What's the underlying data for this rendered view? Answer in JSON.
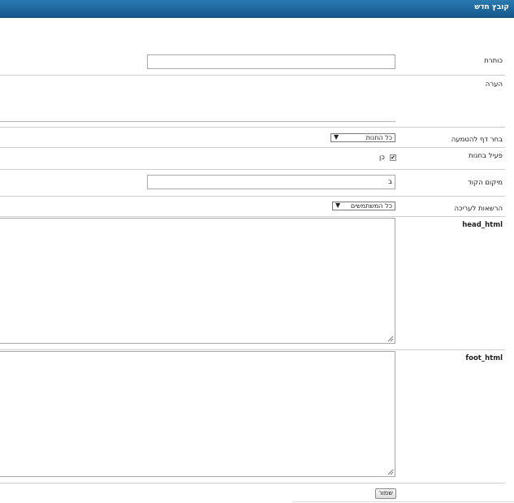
{
  "header": {
    "title": "קובץ חדש"
  },
  "form": {
    "title_label": "כותרת",
    "title_value": "",
    "note_label": "הערה",
    "theme_page_label": "בחר דף להטמעה",
    "theme_page_select": {
      "selected": "כל החנות",
      "arrow": "▼"
    },
    "active_label": "פעיל בחנות",
    "active_option_label": "כן",
    "active_checked": true,
    "code_location_label": "מיקום הקוד",
    "code_location_value": "ב",
    "edit_permissions_label": "הרשאות לעריכה",
    "edit_permissions_select": {
      "selected": "כל המשתמשים",
      "arrow": "▼"
    },
    "head_html_label": "head_html",
    "foot_html_label": "foot_html",
    "save_label": "שמור"
  }
}
